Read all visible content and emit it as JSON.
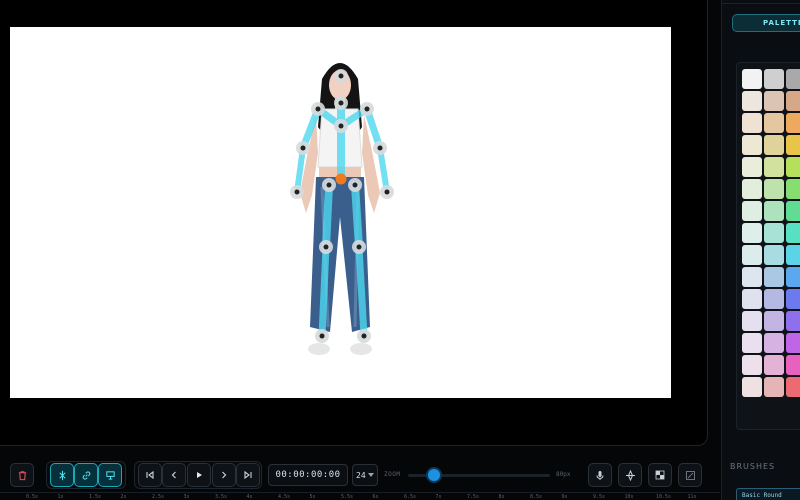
{
  "right_panel": {
    "tab_palette": "PALETTE",
    "section_brushes": "BRUSHES",
    "brush_selected": "Basic Round",
    "swatches": [
      [
        "#f2f2f2",
        "#cfcfcf",
        "#a9a9a9"
      ],
      [
        "#ece6df",
        "#dbc4b3",
        "#d6a888"
      ],
      [
        "#efe2d3",
        "#e4c6a0",
        "#eda95e"
      ],
      [
        "#ede7d4",
        "#e0d39a",
        "#e9c449"
      ],
      [
        "#e9edd9",
        "#d2e29e",
        "#b4e05a"
      ],
      [
        "#e2eddc",
        "#bfe2ad",
        "#86dd70"
      ],
      [
        "#dfeee3",
        "#ade2bd",
        "#5fdd92"
      ],
      [
        "#deeeeb",
        "#a8e2d6",
        "#58e0c3"
      ],
      [
        "#dceced",
        "#a9dbe2",
        "#5ad4e6"
      ],
      [
        "#dde6ee",
        "#aac7e3",
        "#5aa8ee"
      ],
      [
        "#dfe1ef",
        "#b3b9e3",
        "#6b7aee"
      ],
      [
        "#e4e0ef",
        "#c3b5e3",
        "#8f6fee"
      ],
      [
        "#eadfee",
        "#d6b2e3",
        "#c165e8"
      ],
      [
        "#eee0ea",
        "#e3b2d4",
        "#e861bf"
      ],
      [
        "#efe1e2",
        "#e5b4b7",
        "#ee6a73"
      ]
    ]
  },
  "toolbar": {
    "timecode": "00:00:00:00",
    "fps": "24",
    "zoom_label": "ZOOM",
    "zoom_value": "80px",
    "zoom_fraction": 0.18,
    "icons": {
      "delete": "trash-icon",
      "bone": "bone-icon",
      "link": "link-icon",
      "frame": "frame-icon",
      "first": "skip-to-start-icon",
      "prev": "step-back-icon",
      "play": "play-icon",
      "next": "step-forward-icon",
      "last": "skip-to-end-icon",
      "mic": "microphone-icon",
      "target": "target-icon",
      "grid": "checker-icon",
      "export": "image-export-icon"
    }
  },
  "ruler": {
    "ticks": [
      "0.5s",
      "1s",
      "1.5s",
      "2s",
      "2.5s",
      "3s",
      "3.5s",
      "4s",
      "4.5s",
      "5s",
      "5.5s",
      "6s",
      "6.5s",
      "7s",
      "7.5s",
      "8s",
      "8.5s",
      "9s",
      "9.5s",
      "10s",
      "10.5s",
      "11s"
    ]
  },
  "colors": {
    "accent": "#1aa7b8",
    "joint_root": "#f07a1f",
    "bone": "#4fd8f0",
    "zoom_thumb": "#1f8fe0"
  }
}
